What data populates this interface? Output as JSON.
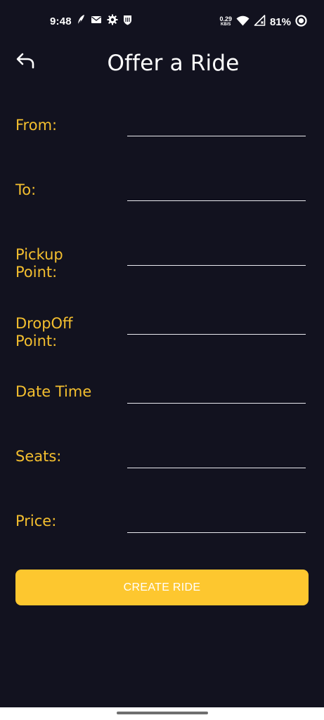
{
  "status_bar": {
    "time": "9:48",
    "net_speed_value": "0.29",
    "net_speed_unit": "KB/S",
    "battery_percent": "81%",
    "left_icons": [
      "feather-app-icon",
      "mail-notification-icon",
      "settings-gear-icon",
      "shield-app-icon"
    ]
  },
  "header": {
    "title": "Offer a Ride",
    "back_icon": "back-arrow-icon"
  },
  "form": {
    "fields": [
      {
        "label": "From:",
        "value": "",
        "placeholder": ""
      },
      {
        "label": "To:",
        "value": "",
        "placeholder": ""
      },
      {
        "label": "Pickup Point:",
        "value": "",
        "placeholder": ""
      },
      {
        "label": "DropOff Point:",
        "value": "",
        "placeholder": ""
      },
      {
        "label": "Date Time",
        "value": "",
        "placeholder": ""
      },
      {
        "label": "Seats:",
        "value": "",
        "placeholder": ""
      },
      {
        "label": "Price:",
        "value": "",
        "placeholder": ""
      }
    ],
    "submit_label": "CREATE RIDE"
  },
  "colors": {
    "background": "#12121f",
    "accent": "#fdc72f",
    "label": "#f4bf2f",
    "text": "#ffffff"
  }
}
